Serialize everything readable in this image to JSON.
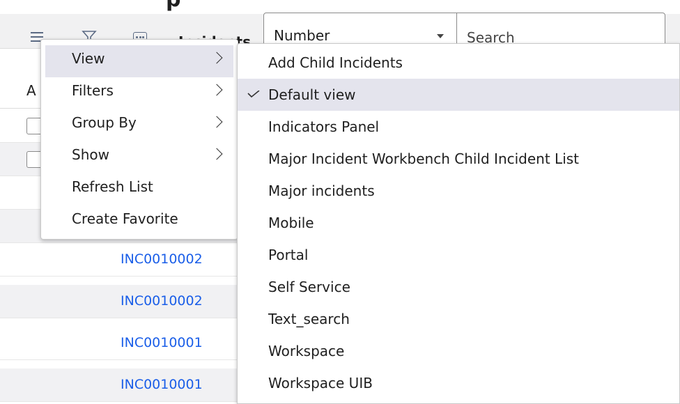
{
  "page": {
    "title_fragment": "p"
  },
  "toolbar": {
    "menu_icon": "hamburger-icon",
    "filter_icon": "funnel-icon",
    "more_icon": "ellipsis-icon",
    "list_title": "Incidents",
    "field_select_value": "Number",
    "search_placeholder": "Search"
  },
  "list": {
    "header_col": "A",
    "rows": [
      {
        "number": ""
      },
      {
        "number": ""
      },
      {
        "number": ""
      },
      {
        "number": ""
      },
      {
        "number": "INC0010002"
      },
      {
        "number": "INC0010002"
      },
      {
        "number": "INC0010001"
      },
      {
        "number": "INC0010001"
      }
    ]
  },
  "context_menu": {
    "items": [
      {
        "label": "View",
        "has_submenu": true,
        "active": true
      },
      {
        "label": "Filters",
        "has_submenu": true
      },
      {
        "label": "Group By",
        "has_submenu": true
      },
      {
        "label": "Show",
        "has_submenu": true
      },
      {
        "label": "Refresh List",
        "has_submenu": false
      },
      {
        "label": "Create Favorite",
        "has_submenu": false
      }
    ]
  },
  "view_submenu": {
    "selected": "Default view",
    "items": [
      "Add Child Incidents",
      "Default view",
      "Indicators Panel",
      "Major Incident Workbench Child Incident List",
      "Major incidents",
      "Mobile",
      "Portal",
      "Self Service",
      "Text_search",
      "Workspace",
      "Workspace UIB"
    ]
  },
  "colors": {
    "link": "#1a5ee8",
    "toolbar_bg": "#f1f1f2",
    "selected_bg": "#e4e4ed",
    "icon": "#5c6b84"
  }
}
